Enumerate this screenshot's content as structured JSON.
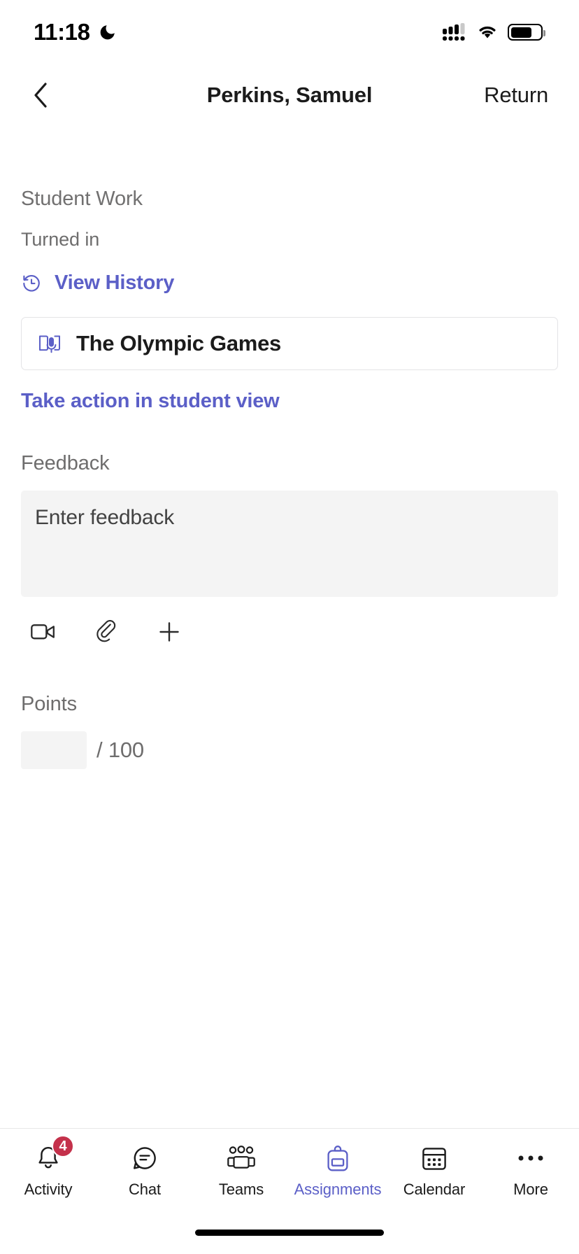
{
  "status_bar": {
    "time": "11:18",
    "moon_icon": "crescent-moon-icon",
    "signal_icon": "cellular-signal-icon",
    "wifi_icon": "wifi-icon",
    "battery_icon": "battery-icon",
    "battery_level_pct": 72
  },
  "nav": {
    "back_icon": "chevron-left-icon",
    "title": "Perkins, Samuel",
    "return_label": "Return"
  },
  "student_work": {
    "section_label": "Student Work",
    "status": "Turned in",
    "view_history": {
      "icon": "history-clock-icon",
      "label": "View History"
    },
    "submission": {
      "icon": "reading-progress-book-mic-icon",
      "title": "The Olympic Games"
    },
    "take_action_label": "Take action in student view"
  },
  "feedback": {
    "label": "Feedback",
    "placeholder": "Enter feedback",
    "value": "",
    "tools": [
      {
        "name": "video-camera-icon",
        "label": "Record video"
      },
      {
        "name": "paperclip-icon",
        "label": "Attach file"
      },
      {
        "name": "plus-icon",
        "label": "Add more"
      }
    ]
  },
  "points": {
    "label": "Points",
    "value": "",
    "max_label": "/ 100"
  },
  "tab_bar": {
    "active": "Assignments",
    "tabs": [
      {
        "label": "Activity",
        "icon": "bell-icon",
        "badge": "4",
        "active": false
      },
      {
        "label": "Chat",
        "icon": "chat-bubble-icon",
        "badge": "",
        "active": false
      },
      {
        "label": "Teams",
        "icon": "teams-people-icon",
        "badge": "",
        "active": false
      },
      {
        "label": "Assignments",
        "icon": "backpack-icon",
        "badge": "",
        "active": true
      },
      {
        "label": "Calendar",
        "icon": "calendar-icon",
        "badge": "",
        "active": false
      },
      {
        "label": "More",
        "icon": "ellipsis-icon",
        "badge": "",
        "active": false
      }
    ]
  },
  "colors": {
    "accent": "#5b5fc7",
    "badge": "#c4314b",
    "muted_text": "#6e6d6d",
    "field_bg": "#f4f4f4",
    "border": "#e4e4e6"
  },
  "home_indicator": "home-indicator"
}
